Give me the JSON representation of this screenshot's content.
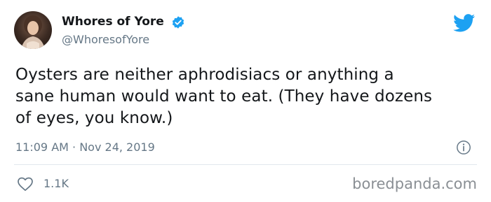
{
  "author": {
    "display_name": "Whores of Yore",
    "handle": "@WhoresofYore",
    "avatar_icon": "portrait-avatar",
    "verified_icon": "verified-badge-icon"
  },
  "tweet": {
    "text_lines": [
      "Oysters are neither aphrodisiacs or anything a",
      "sane human would want to eat. (They have dozens",
      "of eyes, you know.)"
    ],
    "timestamp": "11:09 AM · Nov 24, 2019"
  },
  "actions": {
    "like_count": "1.1K",
    "like_icon": "heart-icon",
    "info_icon": "info-icon"
  },
  "brand": {
    "twitter_icon": "twitter-bird-icon",
    "watermark": "boredpanda.com"
  },
  "colors": {
    "twitter_blue": "#1da1f2",
    "text_primary": "#14171a",
    "text_secondary": "#657786",
    "divider": "#e1e8ed"
  }
}
